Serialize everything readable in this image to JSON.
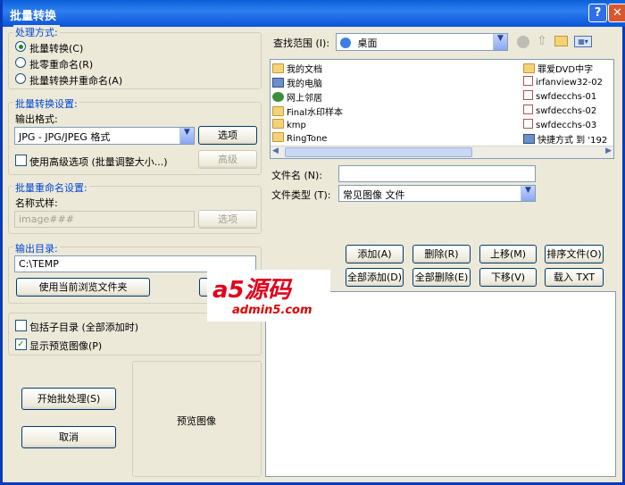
{
  "window": {
    "title": "批量转换",
    "help_label": "?",
    "close_label": "✕"
  },
  "processing": {
    "title": "处理方式:",
    "options": [
      "批量转换(C)",
      "批零重命名(R)",
      "批量转换并重命名(A)"
    ]
  },
  "convert_settings": {
    "title": "批量转换设置:",
    "format_label": "输出格式:",
    "format_value": "JPG - JPG/JPEG 格式",
    "options_button": "选项",
    "advanced_checkbox": "使用高级选项 (批量调整大小...)",
    "advanced_button": "高级"
  },
  "rename_settings": {
    "title": "批量重命名设置:",
    "pattern_label": "名称式样:",
    "pattern_value": "image###",
    "options_button": "选项"
  },
  "output_dir": {
    "title": "输出目录:",
    "value": "C:\\TEMP",
    "use_current_button": "使用当前浏览文件夹"
  },
  "checks": {
    "subdirs": "包括子目录 (全部添加时)",
    "preview": "显示预览图像(P)"
  },
  "preview_label": "预览图像",
  "actions": {
    "start": "开始批处理(S)",
    "cancel": "取消"
  },
  "browser": {
    "lookin_label": "查找范围 (I):",
    "lookin_value": "桌面",
    "files_left": [
      {
        "name": "我的文档",
        "icon": "folder-icon"
      },
      {
        "name": "我的电脑",
        "icon": "computer-icon"
      },
      {
        "name": "网上邻居",
        "icon": "network-icon"
      },
      {
        "name": "Final水印样本",
        "icon": "folder-icon"
      },
      {
        "name": "kmp",
        "icon": "folder-icon"
      },
      {
        "name": "RingTone",
        "icon": "folder-icon"
      }
    ],
    "files_right": [
      {
        "name": "罪爱DVD中字",
        "icon": "folder-icon"
      },
      {
        "name": "irfanview32-02",
        "icon": "document-icon"
      },
      {
        "name": "swfdecchs-01",
        "icon": "document-icon"
      },
      {
        "name": "swfdecchs-02",
        "icon": "document-icon"
      },
      {
        "name": "swfdecchs-03",
        "icon": "document-icon"
      },
      {
        "name": "快捷方式 到 '192",
        "icon": "shortcut-icon"
      }
    ],
    "filename_label": "文件名 (N):",
    "filename_value": "",
    "filetype_label": "文件类型 (T):",
    "filetype_value": "常见图像 文件"
  },
  "list_buttons": {
    "add": "添加(A)",
    "remove": "删除(R)",
    "up": "上移(M)",
    "sort": "排序文件(O)",
    "add_all": "全部添加(D)",
    "remove_all": "全部删除(E)",
    "down": "下移(V)",
    "load_txt": "载入 TXT"
  },
  "watermark": {
    "brand": "a5源码",
    "site": "admin5.com"
  }
}
